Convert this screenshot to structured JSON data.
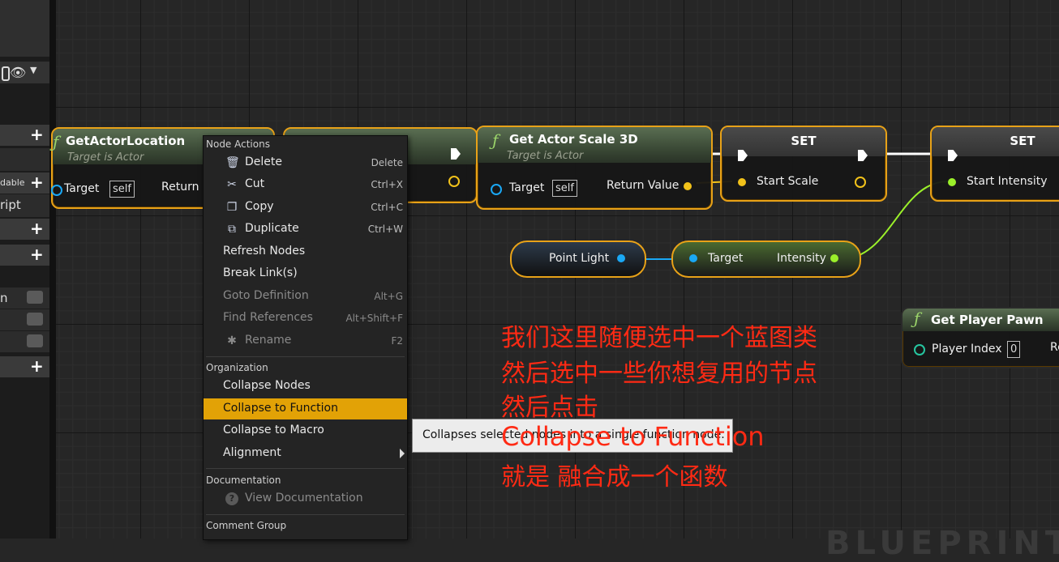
{
  "left_panel": {
    "partial_labels": [
      "dable",
      "ript",
      "n"
    ]
  },
  "nodes": {
    "get_actor_location": {
      "title": "GetActorLocation",
      "subtitle": "Target is Actor",
      "target_label": "Target",
      "target_value": "self",
      "return_label": "Return"
    },
    "get_actor_scale": {
      "title": "Get Actor Scale 3D",
      "subtitle": "Target is Actor",
      "target_label": "Target",
      "target_value": "self",
      "return_label": "Return Value"
    },
    "set_scale": {
      "title": "SET",
      "pin_label": "Start Scale"
    },
    "set_intensity": {
      "title": "SET",
      "pin_label": "Start Intensity"
    },
    "point_light": {
      "label": "Point Light"
    },
    "intensity_getter": {
      "target_label": "Target",
      "output_label": "Intensity"
    },
    "get_player_pawn": {
      "title": "Get Player Pawn",
      "pin_label": "Player Index",
      "pin_value": "0",
      "return_partial": "Re"
    }
  },
  "menu": {
    "section_node_actions": "Node Actions",
    "node_actions": [
      {
        "label": "Delete",
        "shortcut": "Delete",
        "icon": "delete-icon",
        "disabled": false
      },
      {
        "label": "Cut",
        "shortcut": "Ctrl+X",
        "icon": "cut-icon",
        "disabled": false
      },
      {
        "label": "Copy",
        "shortcut": "Ctrl+C",
        "icon": "copy-icon",
        "disabled": false
      },
      {
        "label": "Duplicate",
        "shortcut": "Ctrl+W",
        "icon": "duplicate-icon",
        "disabled": false
      },
      {
        "label": "Refresh Nodes",
        "shortcut": "",
        "icon": "",
        "disabled": false
      },
      {
        "label": "Break Link(s)",
        "shortcut": "",
        "icon": "",
        "disabled": false
      },
      {
        "label": "Goto Definition",
        "shortcut": "Alt+G",
        "icon": "",
        "disabled": true
      },
      {
        "label": "Find References",
        "shortcut": "Alt+Shift+F",
        "icon": "",
        "disabled": true
      },
      {
        "label": "Rename",
        "shortcut": "F2",
        "icon": "rename-icon",
        "disabled": true
      }
    ],
    "section_organization": "Organization",
    "organization": [
      {
        "label": "Collapse Nodes",
        "highlighted": false
      },
      {
        "label": "Collapse to Function",
        "highlighted": true
      },
      {
        "label": "Collapse to Macro",
        "highlighted": false
      },
      {
        "label": "Alignment",
        "highlighted": false,
        "submenu": true
      }
    ],
    "section_documentation": "Documentation",
    "view_documentation": "View Documentation",
    "section_comment_group": "Comment Group"
  },
  "tooltip": {
    "text": "Collapses selected nodes into a single function node."
  },
  "annotation": {
    "lines": [
      "我们这里随便选中一个蓝图类",
      "然后选中一些你想复用的节点",
      "然后点击",
      "Collapse to Function",
      "就是 融合成一个函数"
    ]
  },
  "watermark": "BLUEPRINT",
  "colors": {
    "node_border": "#e8a218",
    "menu_highlight": "#e2a206",
    "vector_pin": "#f2c21a",
    "float_pin": "#9bf02a",
    "object_pin": "#1aa8f5",
    "annotation": "#ff2a14"
  }
}
